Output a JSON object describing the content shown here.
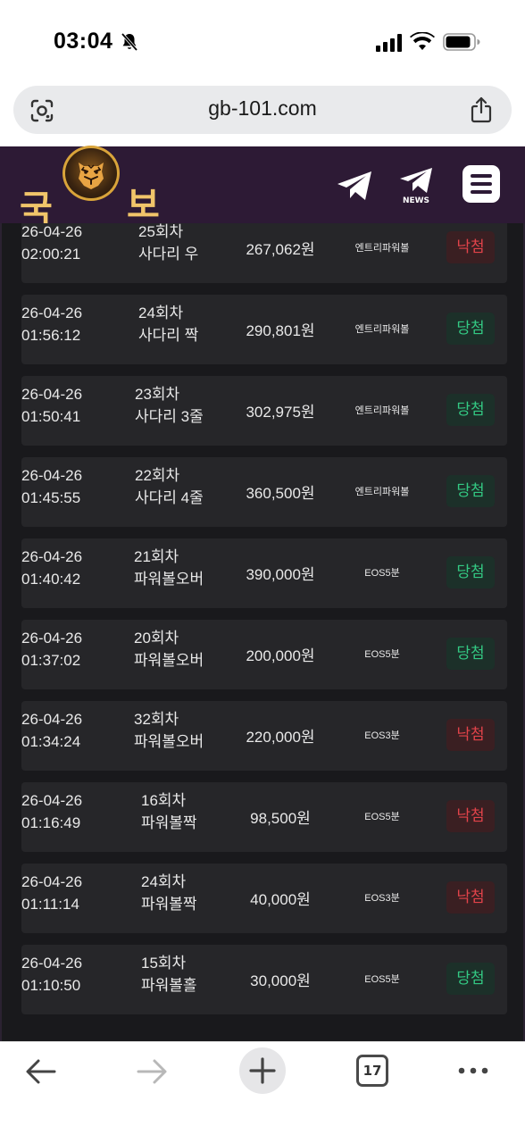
{
  "status_bar": {
    "time": "03:04"
  },
  "browser": {
    "url": "gb-101.com",
    "tab_count": "17"
  },
  "site": {
    "logo_left": "국",
    "logo_right": "보",
    "news_label": "NEWS"
  },
  "rows": [
    {
      "date": "26-04-26",
      "time": "02:00:21",
      "round": "25회차",
      "pick": "사다리 우",
      "amount": "267,062원",
      "game": "엔트리파워볼",
      "result": "낙첨",
      "status": "lose"
    },
    {
      "date": "26-04-26",
      "time": "01:56:12",
      "round": "24회차",
      "pick": "사다리 짝",
      "amount": "290,801원",
      "game": "엔트리파워볼",
      "result": "당첨",
      "status": "win"
    },
    {
      "date": "26-04-26",
      "time": "01:50:41",
      "round": "23회차",
      "pick": "사다리 3줄",
      "amount": "302,975원",
      "game": "엔트리파워볼",
      "result": "당첨",
      "status": "win"
    },
    {
      "date": "26-04-26",
      "time": "01:45:55",
      "round": "22회차",
      "pick": "사다리 4줄",
      "amount": "360,500원",
      "game": "엔트리파워볼",
      "result": "당첨",
      "status": "win"
    },
    {
      "date": "26-04-26",
      "time": "01:40:42",
      "round": "21회차",
      "pick": "파워볼오버",
      "amount": "390,000원",
      "game": "EOS5분",
      "result": "당첨",
      "status": "win"
    },
    {
      "date": "26-04-26",
      "time": "01:37:02",
      "round": "20회차",
      "pick": "파워볼오버",
      "amount": "200,000원",
      "game": "EOS5분",
      "result": "당첨",
      "status": "win"
    },
    {
      "date": "26-04-26",
      "time": "01:34:24",
      "round": "32회차",
      "pick": "파워볼오버",
      "amount": "220,000원",
      "game": "EOS3분",
      "result": "낙첨",
      "status": "lose"
    },
    {
      "date": "26-04-26",
      "time": "01:16:49",
      "round": "16회차",
      "pick": "파워볼짝",
      "amount": "98,500원",
      "game": "EOS5분",
      "result": "낙첨",
      "status": "lose"
    },
    {
      "date": "26-04-26",
      "time": "01:11:14",
      "round": "24회차",
      "pick": "파워볼짝",
      "amount": "40,000원",
      "game": "EOS3분",
      "result": "낙첨",
      "status": "lose"
    },
    {
      "date": "26-04-26",
      "time": "01:10:50",
      "round": "15회차",
      "pick": "파워볼홀",
      "amount": "30,000원",
      "game": "EOS5분",
      "result": "당첨",
      "status": "win"
    }
  ]
}
